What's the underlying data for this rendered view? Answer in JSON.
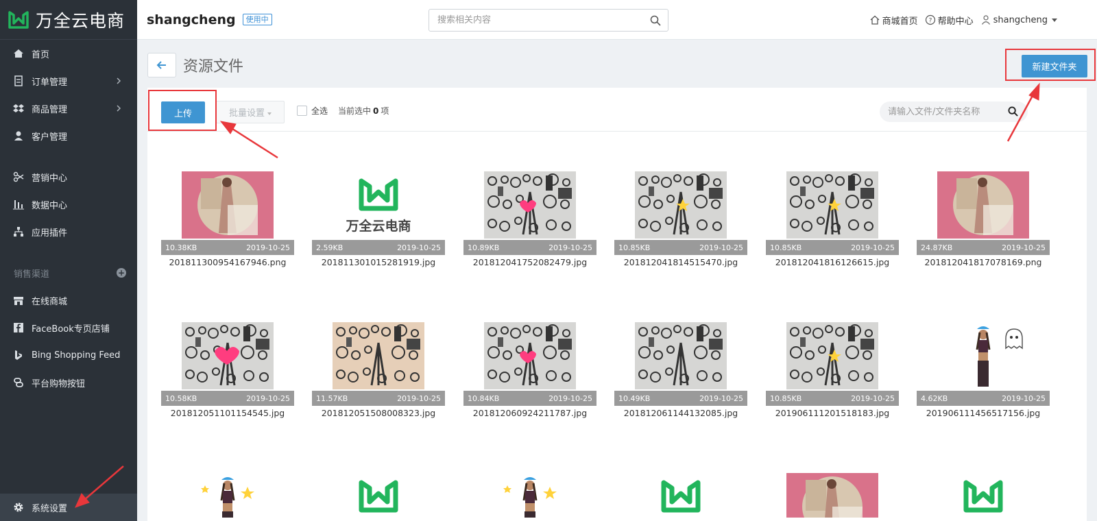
{
  "brand": {
    "name": "万全云电商"
  },
  "sidebar": {
    "items": [
      {
        "label": "首页"
      },
      {
        "label": "订单管理"
      },
      {
        "label": "商品管理"
      },
      {
        "label": "客户管理"
      },
      {
        "label": "营销中心"
      },
      {
        "label": "数据中心"
      },
      {
        "label": "应用插件"
      }
    ],
    "section_title": "销售渠道",
    "channels": [
      {
        "label": "在线商城"
      },
      {
        "label": "FaceBook专页店铺"
      },
      {
        "label": "Bing Shopping Feed"
      },
      {
        "label": "平台购物按钮"
      }
    ],
    "settings_label": "系统设置"
  },
  "header": {
    "shop_name": "shangcheng",
    "badge": "使用中",
    "search_placeholder": "搜索相关内容",
    "links": {
      "home": "商城首页",
      "help": "帮助中心",
      "user": "shangcheng"
    }
  },
  "page": {
    "title": "资源文件",
    "new_folder": "新建文件夹",
    "upload": "上传",
    "batch": "批量设置",
    "select_all": "全选",
    "selected_prefix": "当前选中",
    "selected_count": "0",
    "selected_suffix": "项",
    "file_search_placeholder": "请输入文件/文件夹名称"
  },
  "files": [
    {
      "size": "10.38KB",
      "date": "2019-10-25",
      "name": "201811300954167946.png",
      "thumb": "pink-photo"
    },
    {
      "size": "2.59KB",
      "date": "2019-10-25",
      "name": "201811301015281919.jpg",
      "thumb": "logo"
    },
    {
      "size": "10.89KB",
      "date": "2019-10-25",
      "name": "201812041752082479.jpg",
      "thumb": "camera-heart"
    },
    {
      "size": "10.85KB",
      "date": "2019-10-25",
      "name": "201812041814515470.jpg",
      "thumb": "camera-star"
    },
    {
      "size": "10.85KB",
      "date": "2019-10-25",
      "name": "201812041816126615.jpg",
      "thumb": "camera-star"
    },
    {
      "size": "24.87KB",
      "date": "2019-10-25",
      "name": "201812041817078169.png",
      "thumb": "pink-photo"
    },
    {
      "size": "10.58KB",
      "date": "2019-10-25",
      "name": "201812051101154545.jpg",
      "thumb": "camera-bigheart"
    },
    {
      "size": "11.57KB",
      "date": "2019-10-25",
      "name": "201812051508008323.jpg",
      "thumb": "camera-warm"
    },
    {
      "size": "10.84KB",
      "date": "2019-10-25",
      "name": "201812060924211787.jpg",
      "thumb": "camera-heart"
    },
    {
      "size": "10.49KB",
      "date": "2019-10-25",
      "name": "201812061144132085.jpg",
      "thumb": "camera"
    },
    {
      "size": "10.85KB",
      "date": "2019-10-25",
      "name": "201906111201518183.jpg",
      "thumb": "camera-star"
    },
    {
      "size": "4.62KB",
      "date": "2019-10-25",
      "name": "201906111456517156.jpg",
      "thumb": "girl-ghost"
    }
  ],
  "partial_thumbs": [
    "girl-stars",
    "logo",
    "girl-stars",
    "logo",
    "pink-photo",
    "logo"
  ],
  "colors": {
    "sidebar_bg": "#2b3138",
    "accent": "#3f95d2",
    "annotation": "#e8373b",
    "brand_green": "#22b55c"
  }
}
